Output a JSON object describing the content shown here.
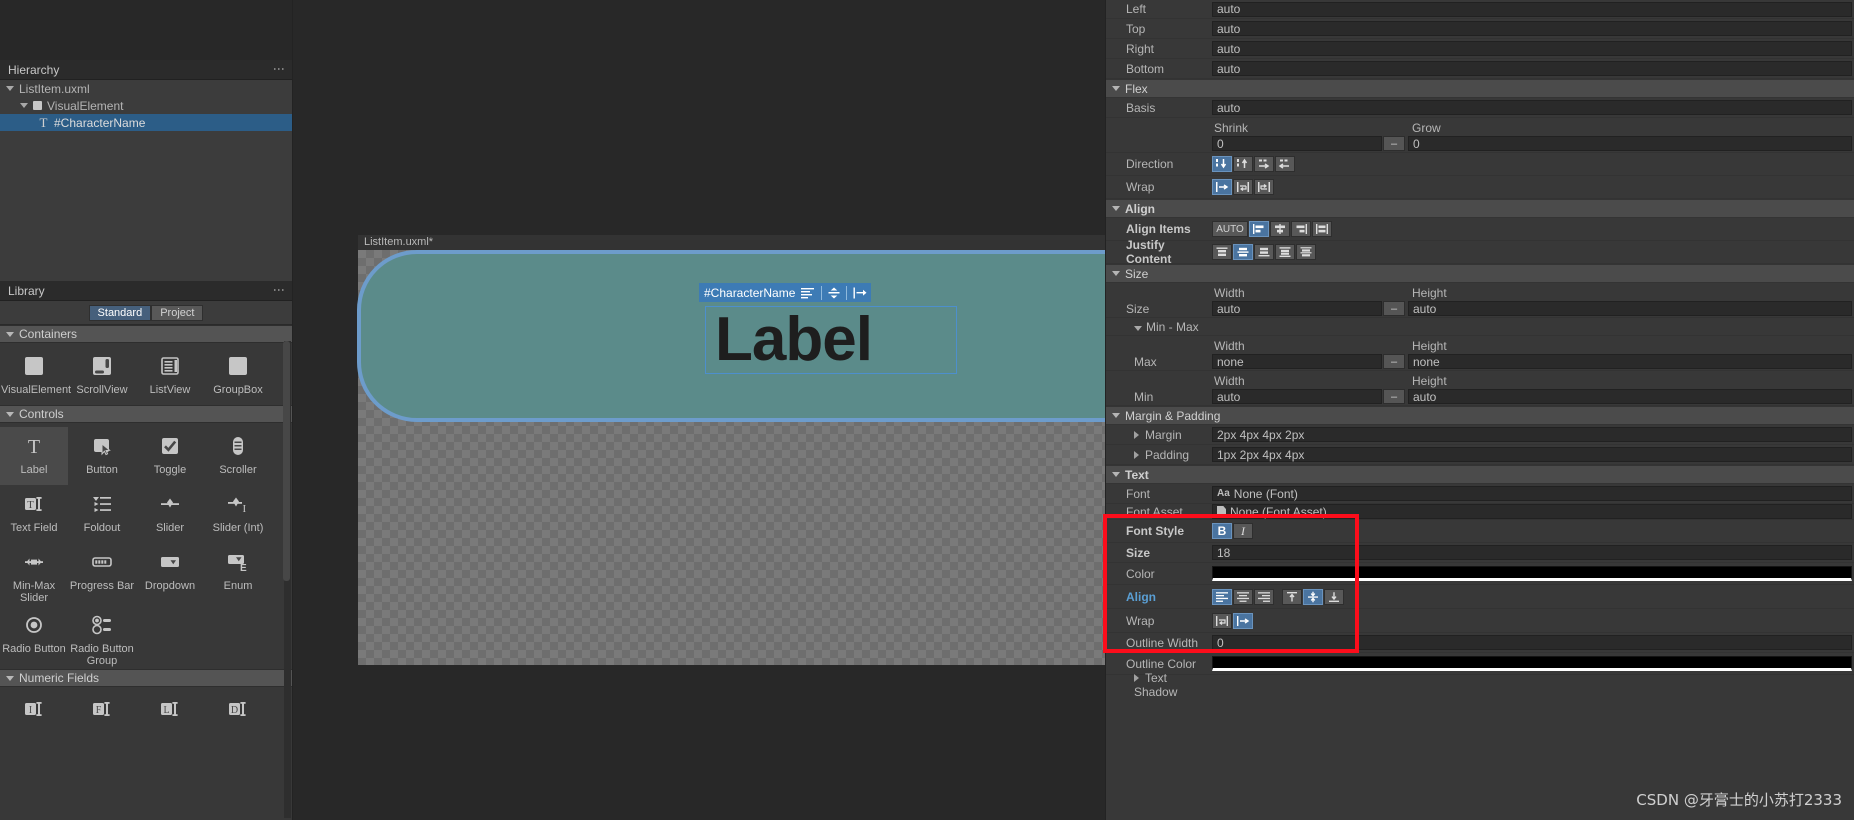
{
  "hierarchy": {
    "title": "Hierarchy",
    "items": [
      {
        "label": "ListItem.uxml",
        "depth": 1,
        "icon": "triangle-down-icon",
        "selected": false
      },
      {
        "label": "VisualElement",
        "depth": 2,
        "icon": "visual-element-icon",
        "selected": false
      },
      {
        "label": "#CharacterName",
        "depth": 3,
        "icon": "text-element-icon",
        "selected": true
      }
    ]
  },
  "library": {
    "title": "Library",
    "tabs": [
      {
        "label": "Standard",
        "active": true
      },
      {
        "label": "Project",
        "active": false
      }
    ],
    "categories": [
      {
        "label": "Containers",
        "items": [
          {
            "label": "VisualElement",
            "icon": "square-icon",
            "selected": false
          },
          {
            "label": "ScrollView",
            "icon": "scrollview-icon",
            "selected": false
          },
          {
            "label": "ListView",
            "icon": "listview-icon",
            "selected": false
          },
          {
            "label": "GroupBox",
            "icon": "groupbox-icon",
            "selected": false
          }
        ]
      },
      {
        "label": "Controls",
        "items": [
          {
            "label": "Label",
            "icon": "label-icon",
            "selected": true
          },
          {
            "label": "Button",
            "icon": "button-icon",
            "selected": false
          },
          {
            "label": "Toggle",
            "icon": "toggle-icon",
            "selected": false
          },
          {
            "label": "Scroller",
            "icon": "scroller-icon",
            "selected": false
          },
          {
            "label": "Text Field",
            "icon": "textfield-icon",
            "selected": false
          },
          {
            "label": "Foldout",
            "icon": "foldout-icon",
            "selected": false
          },
          {
            "label": "Slider",
            "icon": "slider-icon",
            "selected": false
          },
          {
            "label": "Slider (Int)",
            "icon": "slider-int-icon",
            "selected": false
          },
          {
            "label": "Min-Max Slider",
            "icon": "min-max-slider-icon",
            "selected": false
          },
          {
            "label": "Progress Bar",
            "icon": "progress-bar-icon",
            "selected": false
          },
          {
            "label": "Dropdown",
            "icon": "dropdown-icon",
            "selected": false
          },
          {
            "label": "Enum",
            "icon": "enum-icon",
            "selected": false
          },
          {
            "label": "Radio Button",
            "icon": "radio-button-icon",
            "selected": false
          },
          {
            "label": "Radio Button Group",
            "icon": "radio-button-group-icon",
            "selected": false
          }
        ]
      },
      {
        "label": "Numeric Fields",
        "items": [
          {
            "label": "",
            "icon": "integer-field-icon",
            "selected": false
          },
          {
            "label": "",
            "icon": "float-field-icon",
            "selected": false
          },
          {
            "label": "",
            "icon": "long-field-icon",
            "selected": false
          },
          {
            "label": "",
            "icon": "double-field-icon",
            "selected": false
          }
        ]
      }
    ]
  },
  "viewport": {
    "canvas_title": "ListItem.uxml*",
    "selection_tag": "#CharacterName",
    "preview_text": "Label"
  },
  "inspector": {
    "position_rows": [
      {
        "label": "Left",
        "value": "auto"
      },
      {
        "label": "Top",
        "value": "auto"
      },
      {
        "label": "Right",
        "value": "auto"
      },
      {
        "label": "Bottom",
        "value": "auto"
      }
    ],
    "flex": {
      "section": "Flex",
      "basis_label": "Basis",
      "basis_value": "auto",
      "shrink_label": "Shrink",
      "shrink_value": "0",
      "grow_label": "Grow",
      "grow_value": "0",
      "direction_label": "Direction",
      "direction_options": [
        "column",
        "column-reverse",
        "row",
        "row-reverse"
      ],
      "direction_selected": 0,
      "wrap_label": "Wrap",
      "wrap_options": [
        "nowrap",
        "wrap",
        "wrap-reverse"
      ],
      "wrap_selected": 0
    },
    "align": {
      "section": "Align",
      "align_items_label": "Align Items",
      "align_items_auto": "AUTO",
      "align_items_options": [
        "flex-start",
        "center",
        "flex-end",
        "stretch"
      ],
      "align_items_selected": 0,
      "justify_content_label": "Justify Content",
      "justify_content_options": [
        "flex-start",
        "center",
        "flex-end",
        "space-between",
        "space-around"
      ],
      "justify_content_selected": 1
    },
    "size": {
      "section": "Size",
      "width_header": "Width",
      "height_header": "Height",
      "size_label": "Size",
      "size_width": "auto",
      "size_height": "auto",
      "minmax_label": "Min - Max",
      "max_label": "Max",
      "max_width": "none",
      "max_height": "none",
      "min_label": "Min",
      "min_width": "auto",
      "min_height": "auto"
    },
    "margin_padding": {
      "section": "Margin & Padding",
      "margin_label": "Margin",
      "margin_value": "2px 4px 4px 2px",
      "padding_label": "Padding",
      "padding_value": "1px 2px 4px 4px"
    },
    "text": {
      "section": "Text",
      "font_label": "Font",
      "font_value": "None (Font)",
      "font_asset_label": "Font Asset",
      "font_asset_value": "None (Font Asset)",
      "font_style_label": "Font Style",
      "font_style_bold": "B",
      "font_style_italic": "I",
      "font_style_bold_on": true,
      "font_style_italic_on": false,
      "size_label": "Size",
      "size_value": "18",
      "color_label": "Color",
      "color_value": "#000000",
      "align_label": "Align",
      "align_h_options": [
        "left",
        "center",
        "right"
      ],
      "align_h_selected": 0,
      "align_v_options": [
        "upper",
        "middle",
        "lower"
      ],
      "align_v_selected": 1,
      "wrap_label": "Wrap",
      "wrap_options": [
        "wrap",
        "nowrap"
      ],
      "wrap_selected": 1,
      "outline_width_label": "Outline Width",
      "outline_width_value": "0",
      "outline_color_label": "Outline Color",
      "outline_color_value": "#000000",
      "text_shadow_label": "Text Shadow"
    }
  },
  "watermark": "CSDN @牙膏士的小苏打2333"
}
